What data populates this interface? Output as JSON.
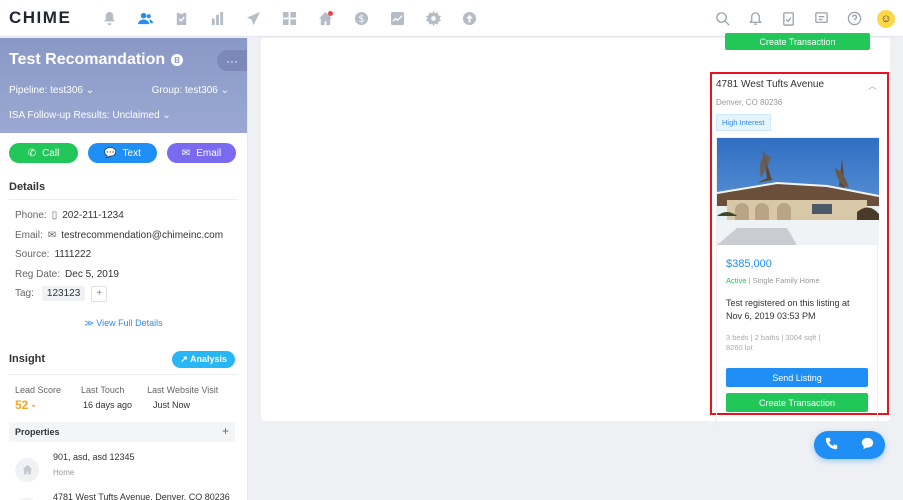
{
  "app": {
    "logo": "CHIME"
  },
  "lead": {
    "name": "Test Recomandation",
    "badge": "B",
    "pipeline_label": "Pipeline:",
    "pipeline_value": "test306",
    "group_label": "Group:",
    "group_value": "test306",
    "isa_label": "ISA Follow-up Results:",
    "isa_value": "Unclaimed",
    "more": "···"
  },
  "actions": {
    "call": "Call",
    "text": "Text",
    "email": "Email"
  },
  "details": {
    "title": "Details",
    "phone_label": "Phone:",
    "phone": "202-211-1234",
    "email_label": "Email:",
    "email": "testrecommendation@chimeinc.com",
    "source_label": "Source:",
    "source": "1111222",
    "reg_label": "Reg Date:",
    "reg_date": "Dec 5, 2019",
    "tag_label": "Tag:",
    "tag": "123123",
    "view_full": "View Full Details"
  },
  "insight": {
    "title": "Insight",
    "analysis": "Analysis",
    "lead_score_label": "Lead Score",
    "last_touch_label": "Last Touch",
    "last_visit_label": "Last Website Visit",
    "lead_score": "52 -",
    "last_touch": "16 days ago",
    "last_visit": "Just Now"
  },
  "properties": {
    "title": "Properties",
    "items": [
      {
        "address": "901, asd, asd 12345",
        "sub": "Home"
      },
      {
        "address": "4781 West Tufts Avenue, Denver, CO 80236",
        "sub": ""
      }
    ]
  },
  "listing": {
    "top_create": "Create Transaction",
    "address": "4781 West Tufts Avenue",
    "city": "Denver, CO 80236",
    "interest": "High Interest",
    "price": "$385,000",
    "status": "Active",
    "type": "Single Family Home",
    "registered": "Test registered on this listing at Nov 6, 2019 03:53 PM",
    "beds": "3 beds",
    "baths": "2 baths",
    "sqft": "3004 sqft",
    "lot": "8260 lot",
    "send": "Send Listing",
    "create": "Create Transaction"
  }
}
